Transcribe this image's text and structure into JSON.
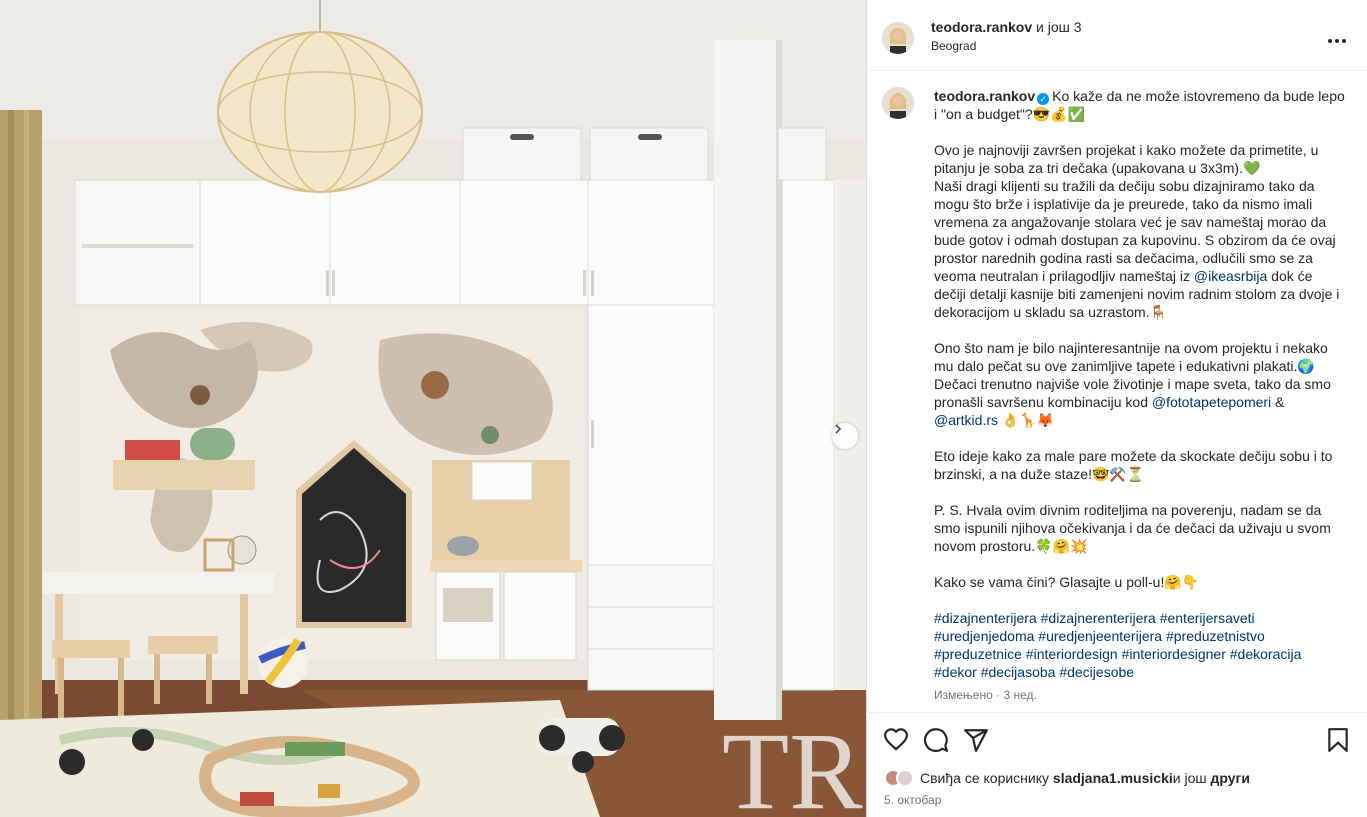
{
  "post": {
    "photo_watermark": "TR"
  },
  "header": {
    "username": "teodora.rankov",
    "and_more": "и још 3",
    "location": "Beograd",
    "more_icon": "more-horizontal-icon"
  },
  "caption": {
    "username": "teodora.rankov",
    "verified_icon": "verified-badge-icon",
    "paragraphs": [
      "Ko kaže da ne može istovremeno da bude lepo i \"on a budget\"?😎💰✅",
      "Ovo je najnoviji završen projekat i kako možete da primetite, u pitanju je soba za tri dečaka (upakovana u 3x3m).💚\nNaši dragi klijenti su tražili da dečiju sobu dizajniramo tako da mogu što brže i isplativije da je preurede, tako da nismo imali vremena za angažovanje stolara već je sav nameštaj morao da bude gotov i odmah dostupan za kupovinu. S obzirom da će ovaj prostor narednih godina rasti sa dečacima, odlučili smo se za veoma neutralan i prilagodljiv nameštaj iz",
      "Ono što nam je bilo najinteresantnije na ovom projektu i nekako mu dalo pečat su ove zanimljive tapete i edukativni plakati.🌍\nDečaci trenutno najviše vole životinje i mape sveta, tako da smo pronašli savršenu kombinaciju kod",
      "Eto ideje kako za male pare možete da skockate dečiju sobu i to brzinski, a na duže staze!🤓⚒️⏳",
      "P. S. Hvala ovim divnim roditeljima na poverenju, nadam se da smo ispunili njihova očekivanja i da će dečaci da uživaju u svom novom prostoru.🍀🤗💥",
      "Kako se vama čini? Glasajte u poll-u!🤗👇"
    ],
    "mention_ikea": "@ikeasrbija",
    "after_ikea": " dok će dečiji detalji kasnije biti zamenjeni novim radnim stolom za dvoje i dekoracijom u skladu sa uzrastom.🪑",
    "mention_foto": "@fototapetepomeri",
    "amp": " & ",
    "mention_artkid": "@artkid.rs",
    "after_artkid": " 👌🦒🦊",
    "hashtags": [
      "#dizajnenterijera",
      "#dizajnerenterijera",
      "#enterijersaveti",
      "#uredjenjedoma",
      "#uredjenjeenterijera",
      "#preduzetnistvo",
      "#preduzetnice",
      "#interiordesign",
      "#interiordesigner",
      "#dekoracija",
      "#dekor",
      "#decijasoba",
      "#decijesobe"
    ],
    "edited": "Измењено · 3 нед."
  },
  "actions": {
    "like_icon": "heart-icon",
    "comment_icon": "comment-icon",
    "share_icon": "send-icon",
    "save_icon": "bookmark-icon",
    "likes_prefix": "Свиђа се кориснику ",
    "likes_user": "sladjana1.musicki",
    "likes_middle": " и још ",
    "likes_others": "други",
    "date": "5. октобар"
  }
}
